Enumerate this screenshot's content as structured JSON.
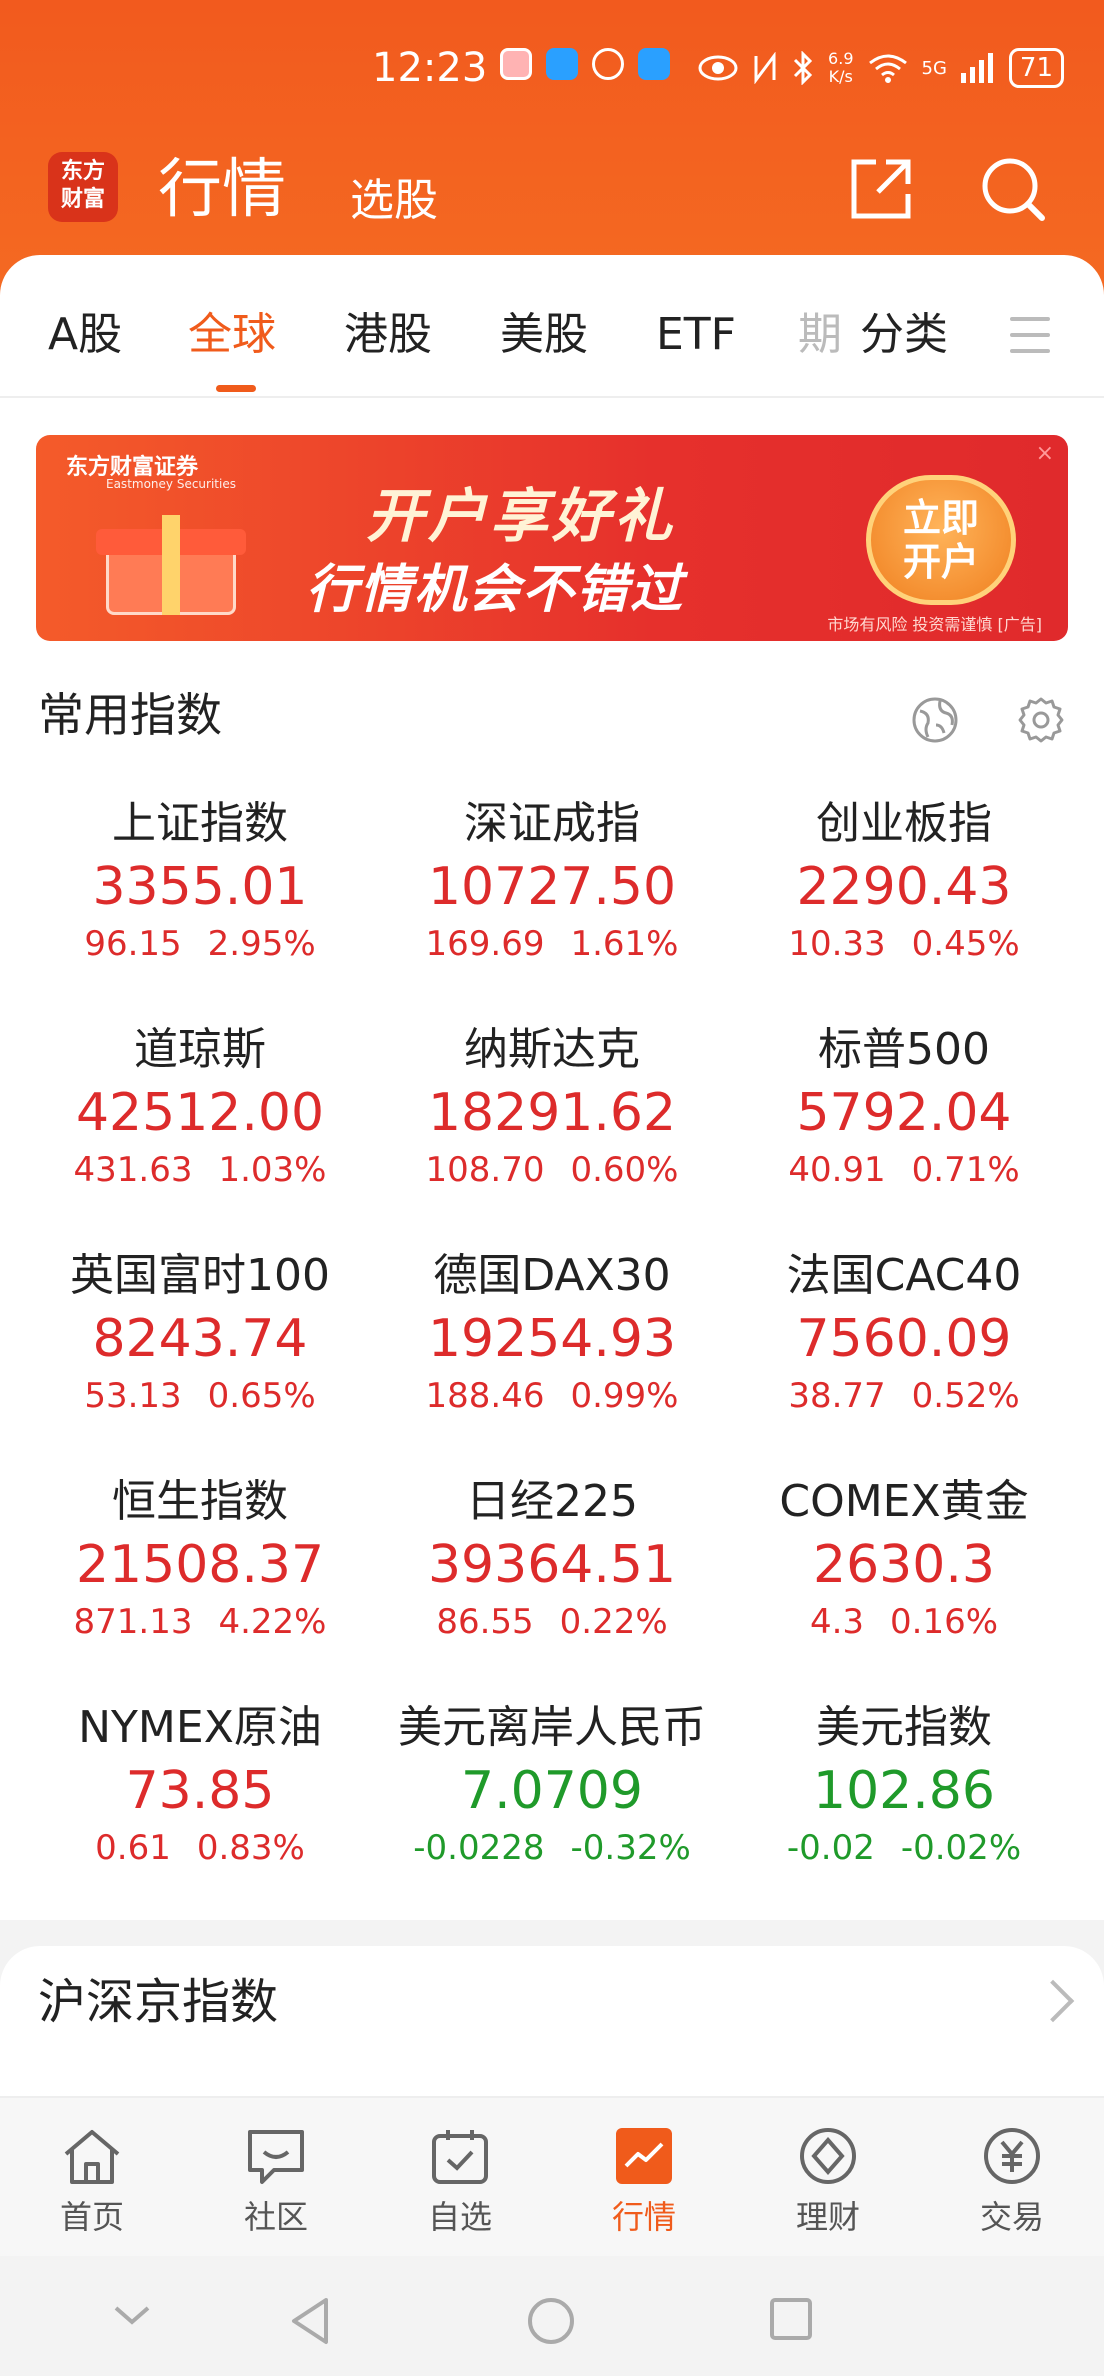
{
  "status_bar": {
    "time": "12:23",
    "net_speed_value": "6.9",
    "net_speed_unit": "K/s",
    "signal_label": "5G",
    "battery": "71"
  },
  "header": {
    "logo_text": "东方\n财富",
    "title": "行情",
    "subtitle": "选股"
  },
  "tabs": [
    {
      "label": "A股",
      "active": false
    },
    {
      "label": "全球",
      "active": true
    },
    {
      "label": "港股",
      "active": false
    },
    {
      "label": "美股",
      "active": false
    },
    {
      "label": "ETF",
      "active": false
    },
    {
      "label": "期",
      "active": false
    },
    {
      "label": "分类",
      "active": false
    }
  ],
  "banner": {
    "brand": "东方财富证券",
    "brand_en": "Eastmoney Securities",
    "line1": "开户享好礼",
    "line2": "行情机会不错过",
    "cta": "立即开户",
    "note": "市场有风险 投资需谨慎 [广告]",
    "close": "×"
  },
  "common_indices": {
    "title": "常用指数",
    "items": [
      {
        "name": "上证指数",
        "price": "3355.01",
        "change": "96.15",
        "pct": "2.95%",
        "dir": "up"
      },
      {
        "name": "深证成指",
        "price": "10727.50",
        "change": "169.69",
        "pct": "1.61%",
        "dir": "up"
      },
      {
        "name": "创业板指",
        "price": "2290.43",
        "change": "10.33",
        "pct": "0.45%",
        "dir": "up"
      },
      {
        "name": "道琼斯",
        "price": "42512.00",
        "change": "431.63",
        "pct": "1.03%",
        "dir": "up"
      },
      {
        "name": "纳斯达克",
        "price": "18291.62",
        "change": "108.70",
        "pct": "0.60%",
        "dir": "up"
      },
      {
        "name": "标普500",
        "price": "5792.04",
        "change": "40.91",
        "pct": "0.71%",
        "dir": "up"
      },
      {
        "name": "英国富时100",
        "price": "8243.74",
        "change": "53.13",
        "pct": "0.65%",
        "dir": "up"
      },
      {
        "name": "德国DAX30",
        "price": "19254.93",
        "change": "188.46",
        "pct": "0.99%",
        "dir": "up"
      },
      {
        "name": "法国CAC40",
        "price": "7560.09",
        "change": "38.77",
        "pct": "0.52%",
        "dir": "up"
      },
      {
        "name": "恒生指数",
        "price": "21508.37",
        "change": "871.13",
        "pct": "4.22%",
        "dir": "up"
      },
      {
        "name": "日经225",
        "price": "39364.51",
        "change": "86.55",
        "pct": "0.22%",
        "dir": "up"
      },
      {
        "name": "COMEX黄金",
        "price": "2630.3",
        "change": "4.3",
        "pct": "0.16%",
        "dir": "up"
      },
      {
        "name": "NYMEX原油",
        "price": "73.85",
        "change": "0.61",
        "pct": "0.83%",
        "dir": "up"
      },
      {
        "name": "美元离岸人民币",
        "price": "7.0709",
        "change": "-0.0228",
        "pct": "-0.32%",
        "dir": "down"
      },
      {
        "name": "美元指数",
        "price": "102.86",
        "change": "-0.02",
        "pct": "-0.02%",
        "dir": "down"
      }
    ]
  },
  "list_section": {
    "title": "沪深京指数"
  },
  "bottom_nav": [
    {
      "label": "首页",
      "icon": "home-icon",
      "active": false
    },
    {
      "label": "社区",
      "icon": "community-icon",
      "active": false
    },
    {
      "label": "自选",
      "icon": "watchlist-icon",
      "active": false
    },
    {
      "label": "行情",
      "icon": "market-icon",
      "active": true
    },
    {
      "label": "理财",
      "icon": "wealth-icon",
      "active": false
    },
    {
      "label": "交易",
      "icon": "trade-icon",
      "active": false
    }
  ],
  "colors": {
    "brand_orange": "#f05b1b",
    "up_red": "#dd2b2b",
    "down_green": "#1f9a2a"
  }
}
